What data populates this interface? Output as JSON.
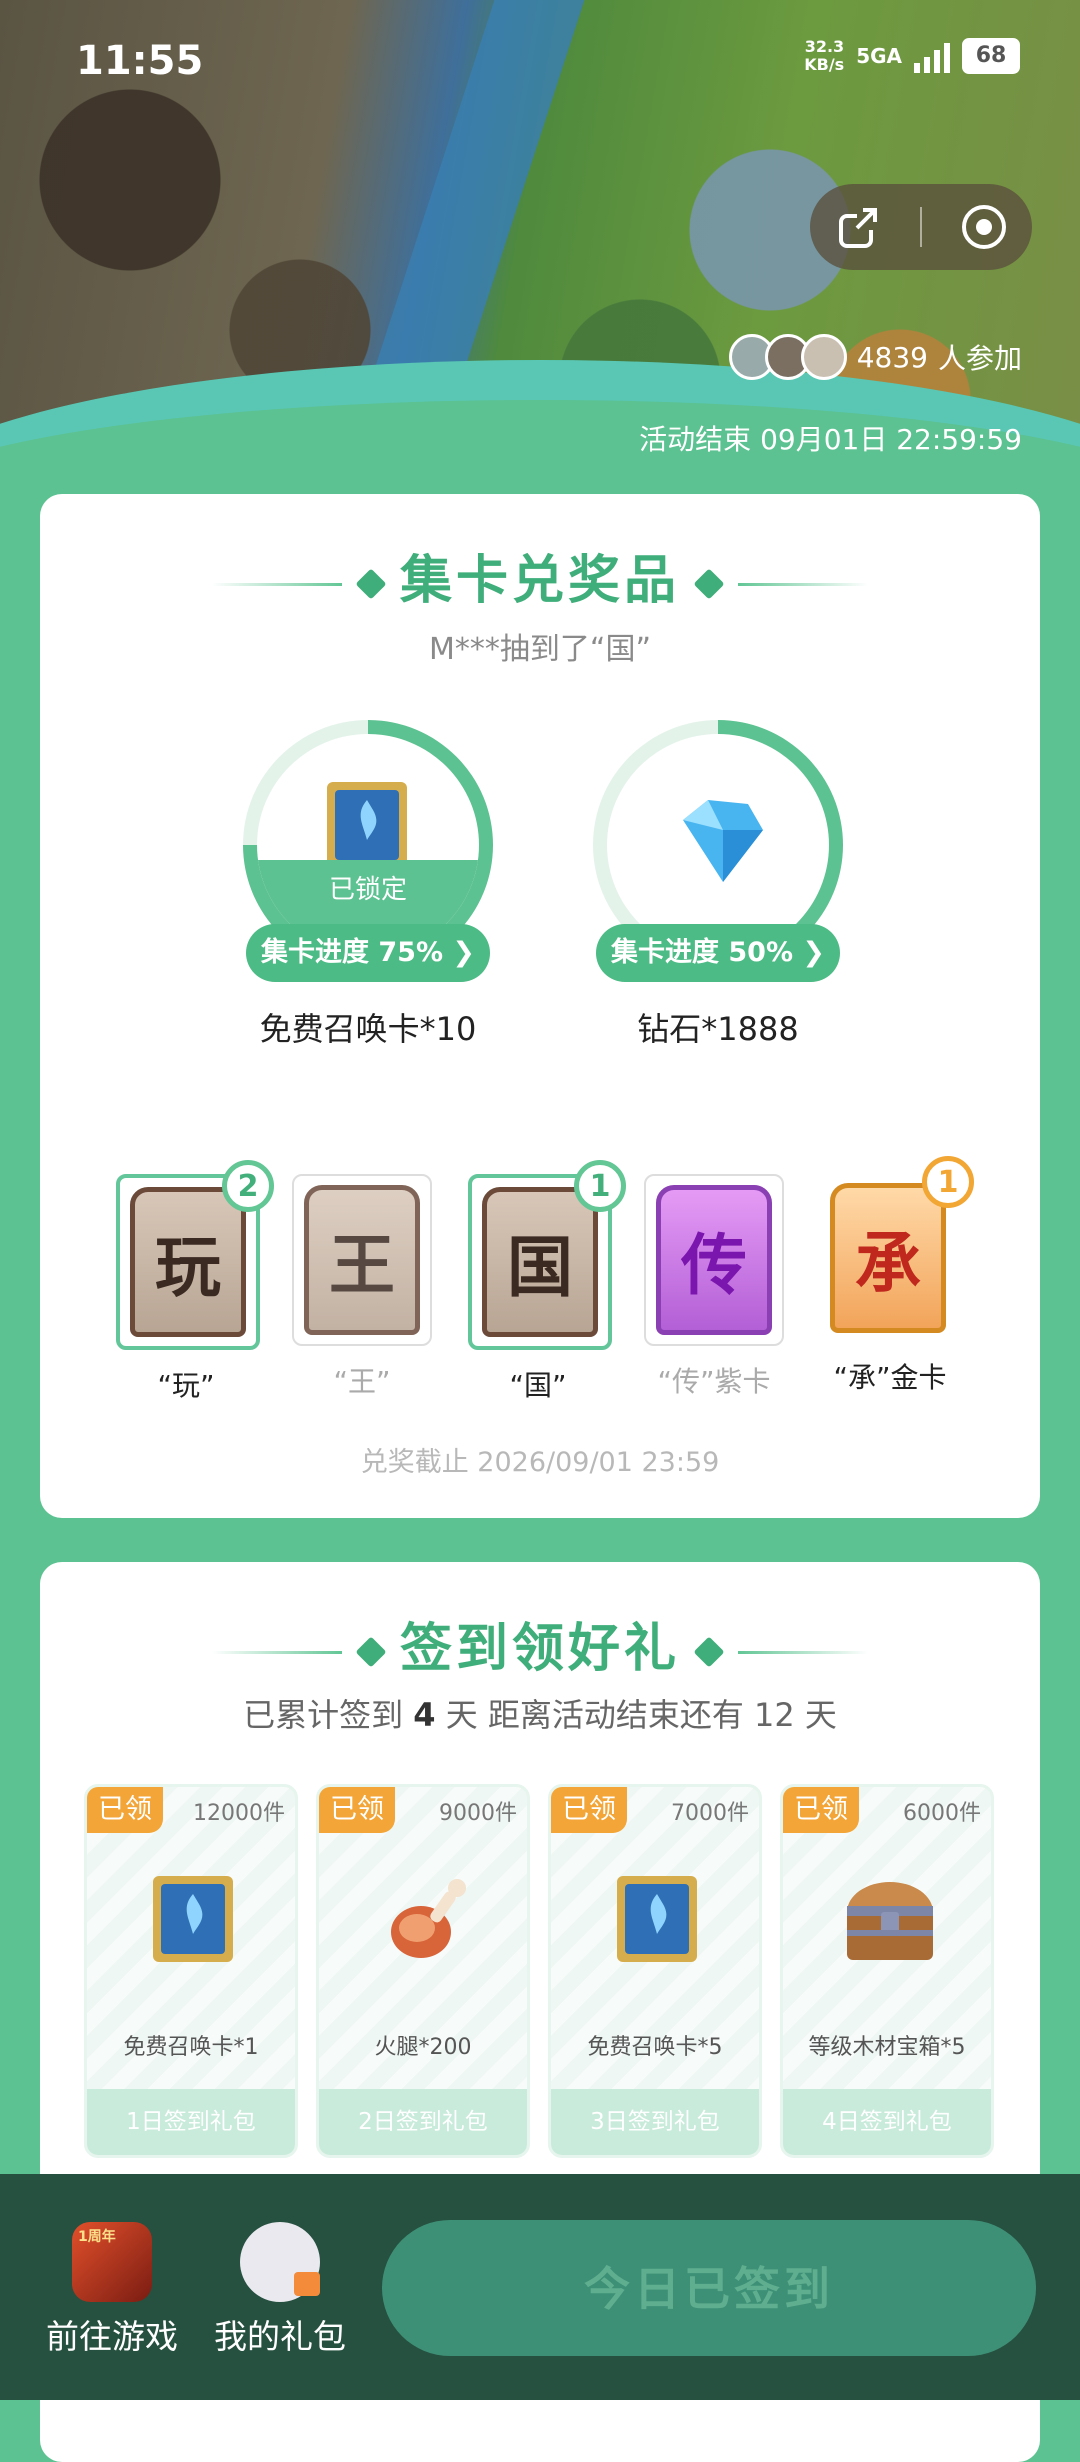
{
  "status_bar": {
    "time": "11:55",
    "net_speed": "32.3",
    "net_unit": "KB/s",
    "network": "5GA",
    "battery": "68"
  },
  "hero": {
    "participants_count": "4839",
    "participants_suffix": "人参加",
    "end_label": "活动结束 09月01日 22:59:59"
  },
  "collect": {
    "title": "集卡兑奖品",
    "broadcast": "M***抽到了“国”",
    "prizes": [
      {
        "name": "免费召唤卡*10",
        "progress_label": "集卡进度 75% ",
        "progress": 0.75,
        "lock_label": "已锁定",
        "icon": "summon-card-icon"
      },
      {
        "name": "钻石*1888",
        "progress_label": "集卡进度 50% ",
        "progress": 0.5,
        "icon": "diamond-icon"
      }
    ],
    "cards": [
      {
        "char": "玩",
        "label": "“玩”",
        "count": "2",
        "owned": true
      },
      {
        "char": "王",
        "label": "“王”",
        "owned": false
      },
      {
        "char": "国",
        "label": "“国”",
        "count": "1",
        "owned": true
      },
      {
        "char": "传",
        "label": "“传”紫卡",
        "owned": false
      },
      {
        "char": "承",
        "label": "“承”金卡",
        "count": "1",
        "owned": true
      }
    ],
    "deadline": "兑奖截止 2026/09/01 23:59"
  },
  "signin": {
    "title": "签到领好礼",
    "sub_prefix": "已累计签到",
    "sub_days": "4",
    "sub_suffix": "天  距离活动结束还有 12 天",
    "gifts": [
      {
        "tag": "已领",
        "stock": "12000件",
        "name": "免费召唤卡*1",
        "day": "1日签到礼包",
        "icon": "summon-card-icon"
      },
      {
        "tag": "已领",
        "stock": "9000件",
        "name": "火腿*200",
        "day": "2日签到礼包",
        "icon": "ham-icon"
      },
      {
        "tag": "已领",
        "stock": "7000件",
        "name": "免费召唤卡*5",
        "day": "3日签到礼包",
        "icon": "summon-card-icon"
      },
      {
        "tag": "已领",
        "stock": "6000件",
        "name": "等级木材宝箱*5",
        "day": "4日签到礼包",
        "icon": "treasure-chest-icon"
      }
    ]
  },
  "bottom_bar": {
    "go_game": "前往游戏",
    "game_badge": "1周年",
    "my_gifts": "我的礼包",
    "cta": "今日已签到"
  },
  "colors": {
    "accent": "#3fae7a",
    "background": "#5cc291",
    "tag": "#f3a637",
    "bottom_bar": "#26503f"
  }
}
